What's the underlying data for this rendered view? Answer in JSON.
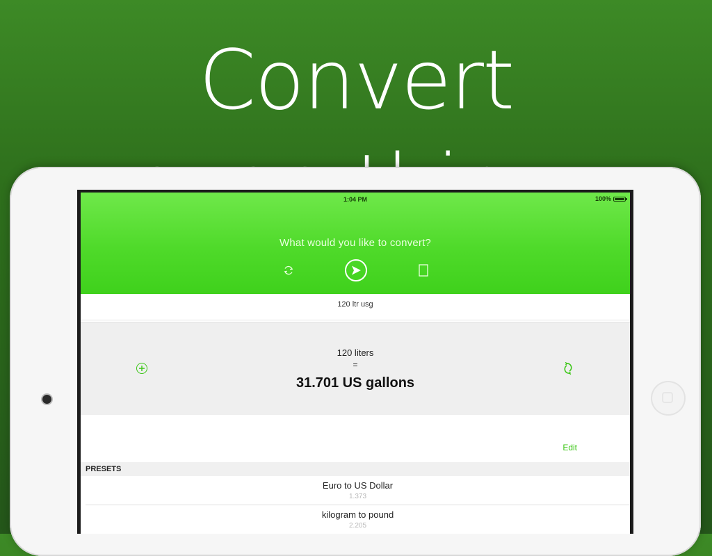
{
  "headline": "Convert everything.",
  "status_bar": {
    "time": "1:04 PM",
    "battery": "100%"
  },
  "prompt": "What would you like to convert?",
  "query": "120 ltr usg",
  "result": {
    "from": "120 liters",
    "equals": "=",
    "to": "31.701 US gallons"
  },
  "edit_label": "Edit",
  "presets": {
    "header": "PRESETS",
    "items": [
      {
        "name": "Euro to US Dollar",
        "value": "1.373"
      },
      {
        "name": "kilogram to pound",
        "value": "2.205"
      }
    ]
  },
  "colors": {
    "accent": "#3cc617",
    "hero": "#4fda2a",
    "background": "#2e6f1c"
  },
  "icons": [
    "refresh-icon",
    "go-arrow-icon",
    "copy-icon",
    "add-icon",
    "swap-icon",
    "battery-icon"
  ]
}
